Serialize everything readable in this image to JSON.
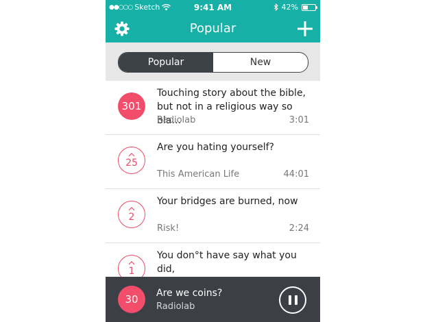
{
  "status_bar": {
    "carrier": "Sketch",
    "time": "9:41 AM",
    "battery": "42%",
    "battery_level": 0.42,
    "signal_dots": "●●○○○"
  },
  "header": {
    "title": "Popular",
    "left_icon": "gear-icon",
    "right_icon": "plus-icon"
  },
  "segmented": {
    "options": [
      "Popular",
      "New"
    ],
    "selected": "Popular"
  },
  "list": [
    {
      "count": "301",
      "title": "Touching story about the bible,\nbut not in a religious way so bla…",
      "source": "Radiolab",
      "duration": "3:01",
      "filled": true
    },
    {
      "count": "25",
      "title": "Are you hating yourself?",
      "source": "This American Life",
      "duration": "44:01",
      "filled": false
    },
    {
      "count": "2",
      "title": "Your bridges are burned, now",
      "source": "Risk!",
      "duration": "2:24",
      "filled": false
    },
    {
      "count": "1",
      "title": "You don°t have say what you did,\nyou already know, I found out f…",
      "source": "",
      "duration": "",
      "filled": false
    }
  ],
  "player": {
    "count": "30",
    "title": "Are we coins?",
    "source": "Radiolab",
    "control": "pause-icon"
  },
  "colors": {
    "teal": "#16b0a6",
    "pink": "#f24d6a",
    "dark": "#3c4046"
  }
}
